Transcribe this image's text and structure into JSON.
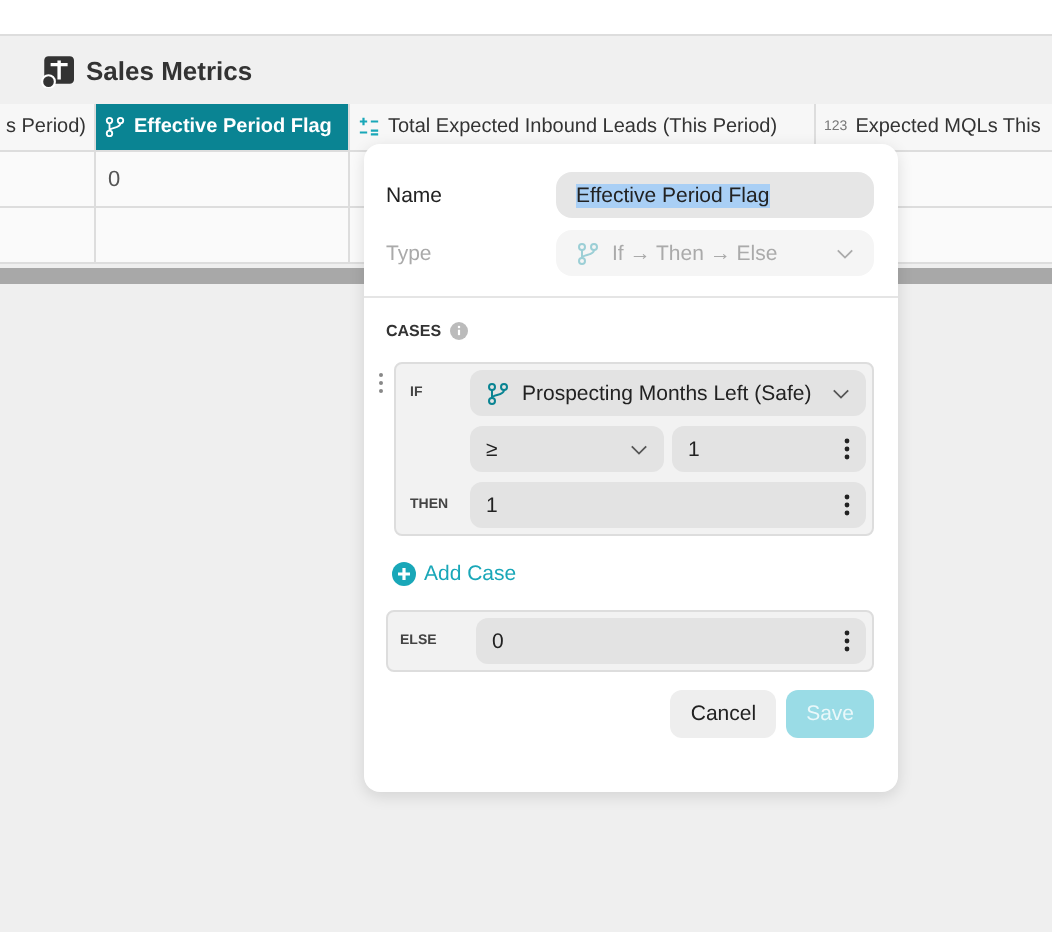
{
  "sheet": {
    "title": "Sales Metrics"
  },
  "table": {
    "columns": [
      {
        "label": "s Period)",
        "kind": "plain",
        "selected": false
      },
      {
        "label": "Effective Period Flag",
        "kind": "branch",
        "selected": true
      },
      {
        "label": "Total Expected Inbound Leads (This Period)",
        "kind": "formula",
        "selected": false
      },
      {
        "label": "Expected MQLs This",
        "kind": "number",
        "icon_text": "123",
        "selected": false
      }
    ],
    "rows": [
      {
        "cells": [
          null,
          "0",
          null,
          null
        ]
      },
      {
        "cells": [
          null,
          null,
          null,
          null
        ]
      }
    ]
  },
  "popup": {
    "name_label": "Name",
    "name_value": "Effective Period Flag",
    "name_selected": true,
    "type_label": "Type",
    "type_value": "If → Then → Else",
    "type_disabled": true,
    "cases_label": "CASES",
    "cases": [
      {
        "if_label": "IF",
        "field": "Prospecting Months Left (Safe)",
        "operator": "≥",
        "value": "1",
        "then_label": "THEN",
        "then_value": "1"
      }
    ],
    "add_case": "Add Case",
    "else_label": "ELSE",
    "else_value": "0",
    "buttons": [
      {
        "label": "Cancel",
        "kind": "secondary",
        "disabled": false
      },
      {
        "label": "Save",
        "kind": "primary",
        "disabled": true
      }
    ]
  }
}
